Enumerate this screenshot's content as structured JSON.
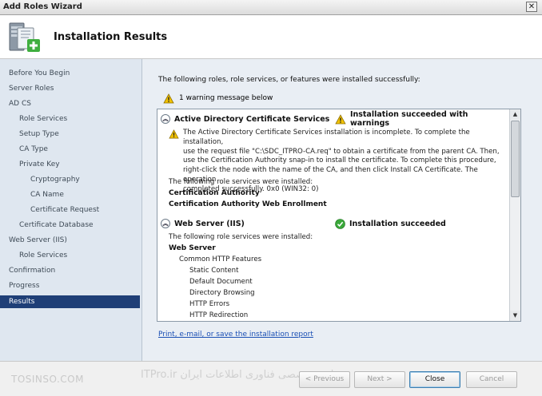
{
  "window": {
    "title": "Add Roles Wizard",
    "close_glyph": "✕"
  },
  "header": {
    "page_title": "Installation Results",
    "icon": "server-add-icon"
  },
  "nav": {
    "items": [
      {
        "label": "Before You Begin",
        "level": 0,
        "selected": false
      },
      {
        "label": "Server Roles",
        "level": 0,
        "selected": false
      },
      {
        "label": "AD CS",
        "level": 0,
        "selected": false
      },
      {
        "label": "Role Services",
        "level": 1,
        "selected": false
      },
      {
        "label": "Setup Type",
        "level": 1,
        "selected": false
      },
      {
        "label": "CA Type",
        "level": 1,
        "selected": false
      },
      {
        "label": "Private Key",
        "level": 1,
        "selected": false
      },
      {
        "label": "Cryptography",
        "level": 2,
        "selected": false
      },
      {
        "label": "CA Name",
        "level": 2,
        "selected": false
      },
      {
        "label": "Certificate Request",
        "level": 2,
        "selected": false
      },
      {
        "label": "Certificate Database",
        "level": 1,
        "selected": false
      },
      {
        "label": "Web Server (IIS)",
        "level": 0,
        "selected": false
      },
      {
        "label": "Role Services",
        "level": 1,
        "selected": false
      },
      {
        "label": "Confirmation",
        "level": 0,
        "selected": false
      },
      {
        "label": "Progress",
        "level": 0,
        "selected": false
      },
      {
        "label": "Results",
        "level": 0,
        "selected": true
      }
    ]
  },
  "main": {
    "intro": "The following roles, role services, or features were installed successfully:",
    "warning_summary": "1 warning message below",
    "sections": [
      {
        "name": "Active Directory Certificate Services",
        "status": "Installation succeeded with warnings",
        "status_icon": "warning-icon",
        "warning_lines": [
          "The Active Directory Certificate Services installation is incomplete. To complete the installation,",
          "use the request file \"C:\\SDC_ITPRO-CA.req\" to obtain a certificate from the parent CA. Then,",
          "use the Certification Authority snap-in to install the certificate. To complete this procedure,",
          "right-click the node with the name of the CA, and then click Install CA Certificate. The operation",
          "completed successfully. 0x0 (WIN32: 0)"
        ],
        "installed_label": "The following role services were installed:",
        "installed": [
          "Certification Authority",
          "Certification Authority Web Enrollment"
        ]
      },
      {
        "name": "Web Server (IIS)",
        "status": "Installation succeeded",
        "status_icon": "check-circle-icon",
        "installed_label": "The following role services were installed:",
        "installed_group": "Web Server",
        "subgroup": "Common HTTP Features",
        "features": [
          "Static Content",
          "Default Document",
          "Directory Browsing",
          "HTTP Errors",
          "HTTP Redirection"
        ]
      }
    ],
    "report_link": "Print, e-mail, or save the installation report"
  },
  "footer": {
    "watermark_left": "TOSINSO.COM",
    "watermark_right": "سایت تخصصی فناوری اطلاعات ایران ITPro.ir",
    "buttons": {
      "previous": "< Previous",
      "next": "Next >",
      "close": "Close",
      "cancel": "Cancel"
    }
  },
  "colors": {
    "nav_bg": "#dfe7f0",
    "nav_selected": "#1f3f77",
    "content_bg": "#e9eef4",
    "link": "#1a4fb4",
    "warning": "#f2c200",
    "success": "#3aa83a"
  }
}
